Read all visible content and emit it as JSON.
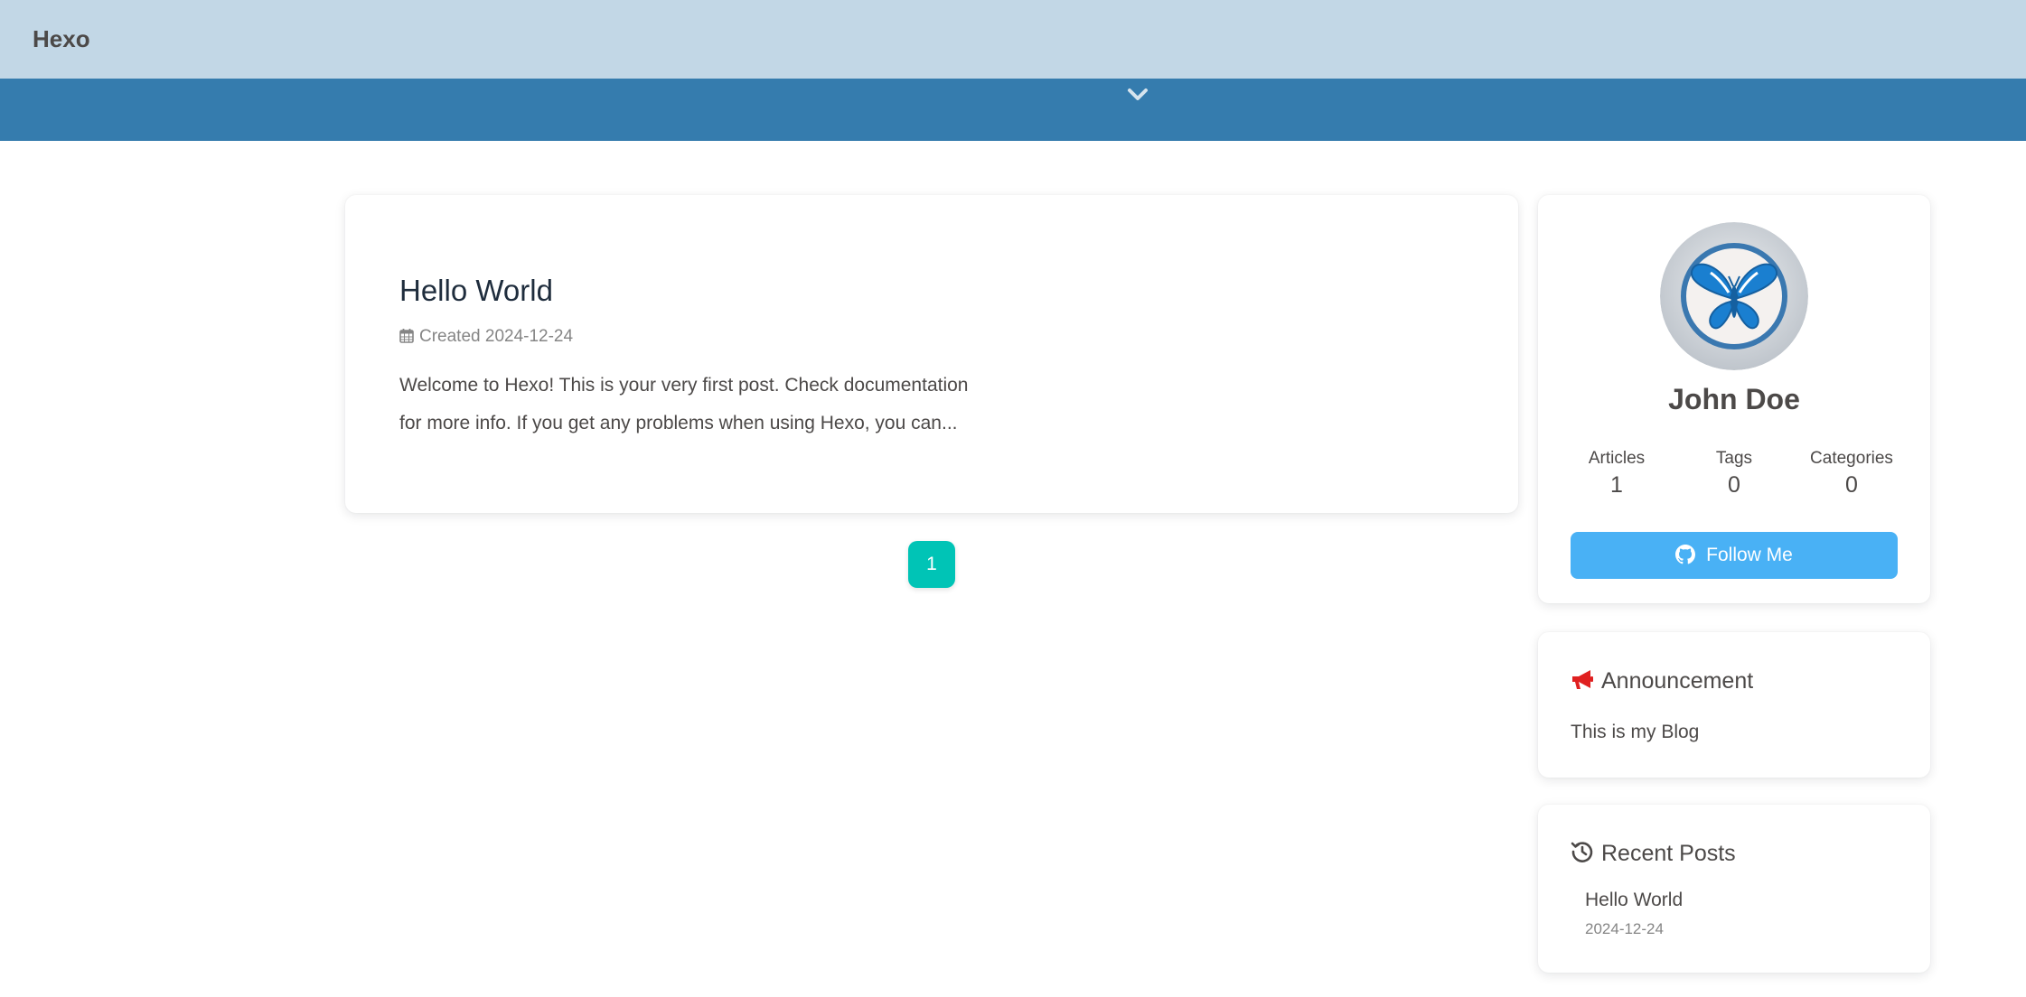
{
  "header": {
    "brand": "Hexo",
    "scroll_icon": "chevron-down-icon"
  },
  "post": {
    "title": "Hello World",
    "meta_icon": "calendar-icon",
    "meta_label": "Created 2024-12-24",
    "excerpt": "Welcome to Hexo! This is your very first post. Check documentation for more info. If you get any problems when using Hexo, you can..."
  },
  "pagination": {
    "current_page": "1"
  },
  "author": {
    "avatar_icon": "butterfly-avatar",
    "name": "John Doe",
    "stats": [
      {
        "label": "Articles",
        "count": "1"
      },
      {
        "label": "Tags",
        "count": "0"
      },
      {
        "label": "Categories",
        "count": "0"
      }
    ],
    "follow_icon": "github-icon",
    "follow_label": "Follow Me"
  },
  "announcement": {
    "icon": "bullhorn-icon",
    "heading": "Announcement",
    "text": "This is my Blog"
  },
  "recent_posts": {
    "icon": "history-icon",
    "heading": "Recent Posts",
    "items": [
      {
        "title": "Hello World",
        "date": "2024-12-24"
      }
    ]
  },
  "colors": {
    "topbar": "#c2d7e6",
    "banner": "#357cae",
    "pager": "#00c4b6",
    "follow_button": "#49b1f5",
    "announcement_icon": "#e02020"
  }
}
